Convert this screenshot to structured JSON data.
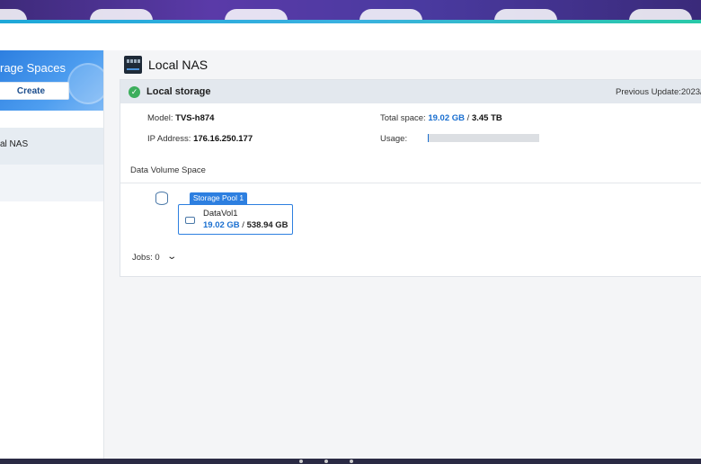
{
  "app": {
    "accent_color": "#2d7fe0"
  },
  "sidebar": {
    "title": "rage Spaces",
    "create_label": "Create",
    "items": [
      {
        "label": "al NAS"
      },
      {
        "label": ""
      }
    ]
  },
  "nas": {
    "title": "Local NAS",
    "icon": "nas-device-icon"
  },
  "storage": {
    "status_icon": "check-circle-icon",
    "heading": "Local storage",
    "previous_update": "Previous Update:2023/",
    "model_label": "Model: ",
    "model_value": "TVS-h874",
    "ip_label": "IP Address: ",
    "ip_value": "176.16.250.177",
    "total_label": "Total space: ",
    "total_used": "19.02 GB",
    "total_sep": " / ",
    "total_capacity": "3.45 TB",
    "usage_label": "Usage:",
    "usage_fraction": 0.0055
  },
  "data_volume": {
    "section_label": "Data Volume Space",
    "pool_label": "Storage Pool 1",
    "volume_name": "DataVol1",
    "volume_used": "19.02 GB",
    "volume_sep": " / ",
    "volume_capacity": "538.94 GB"
  },
  "jobs": {
    "label": "Jobs: 0"
  }
}
